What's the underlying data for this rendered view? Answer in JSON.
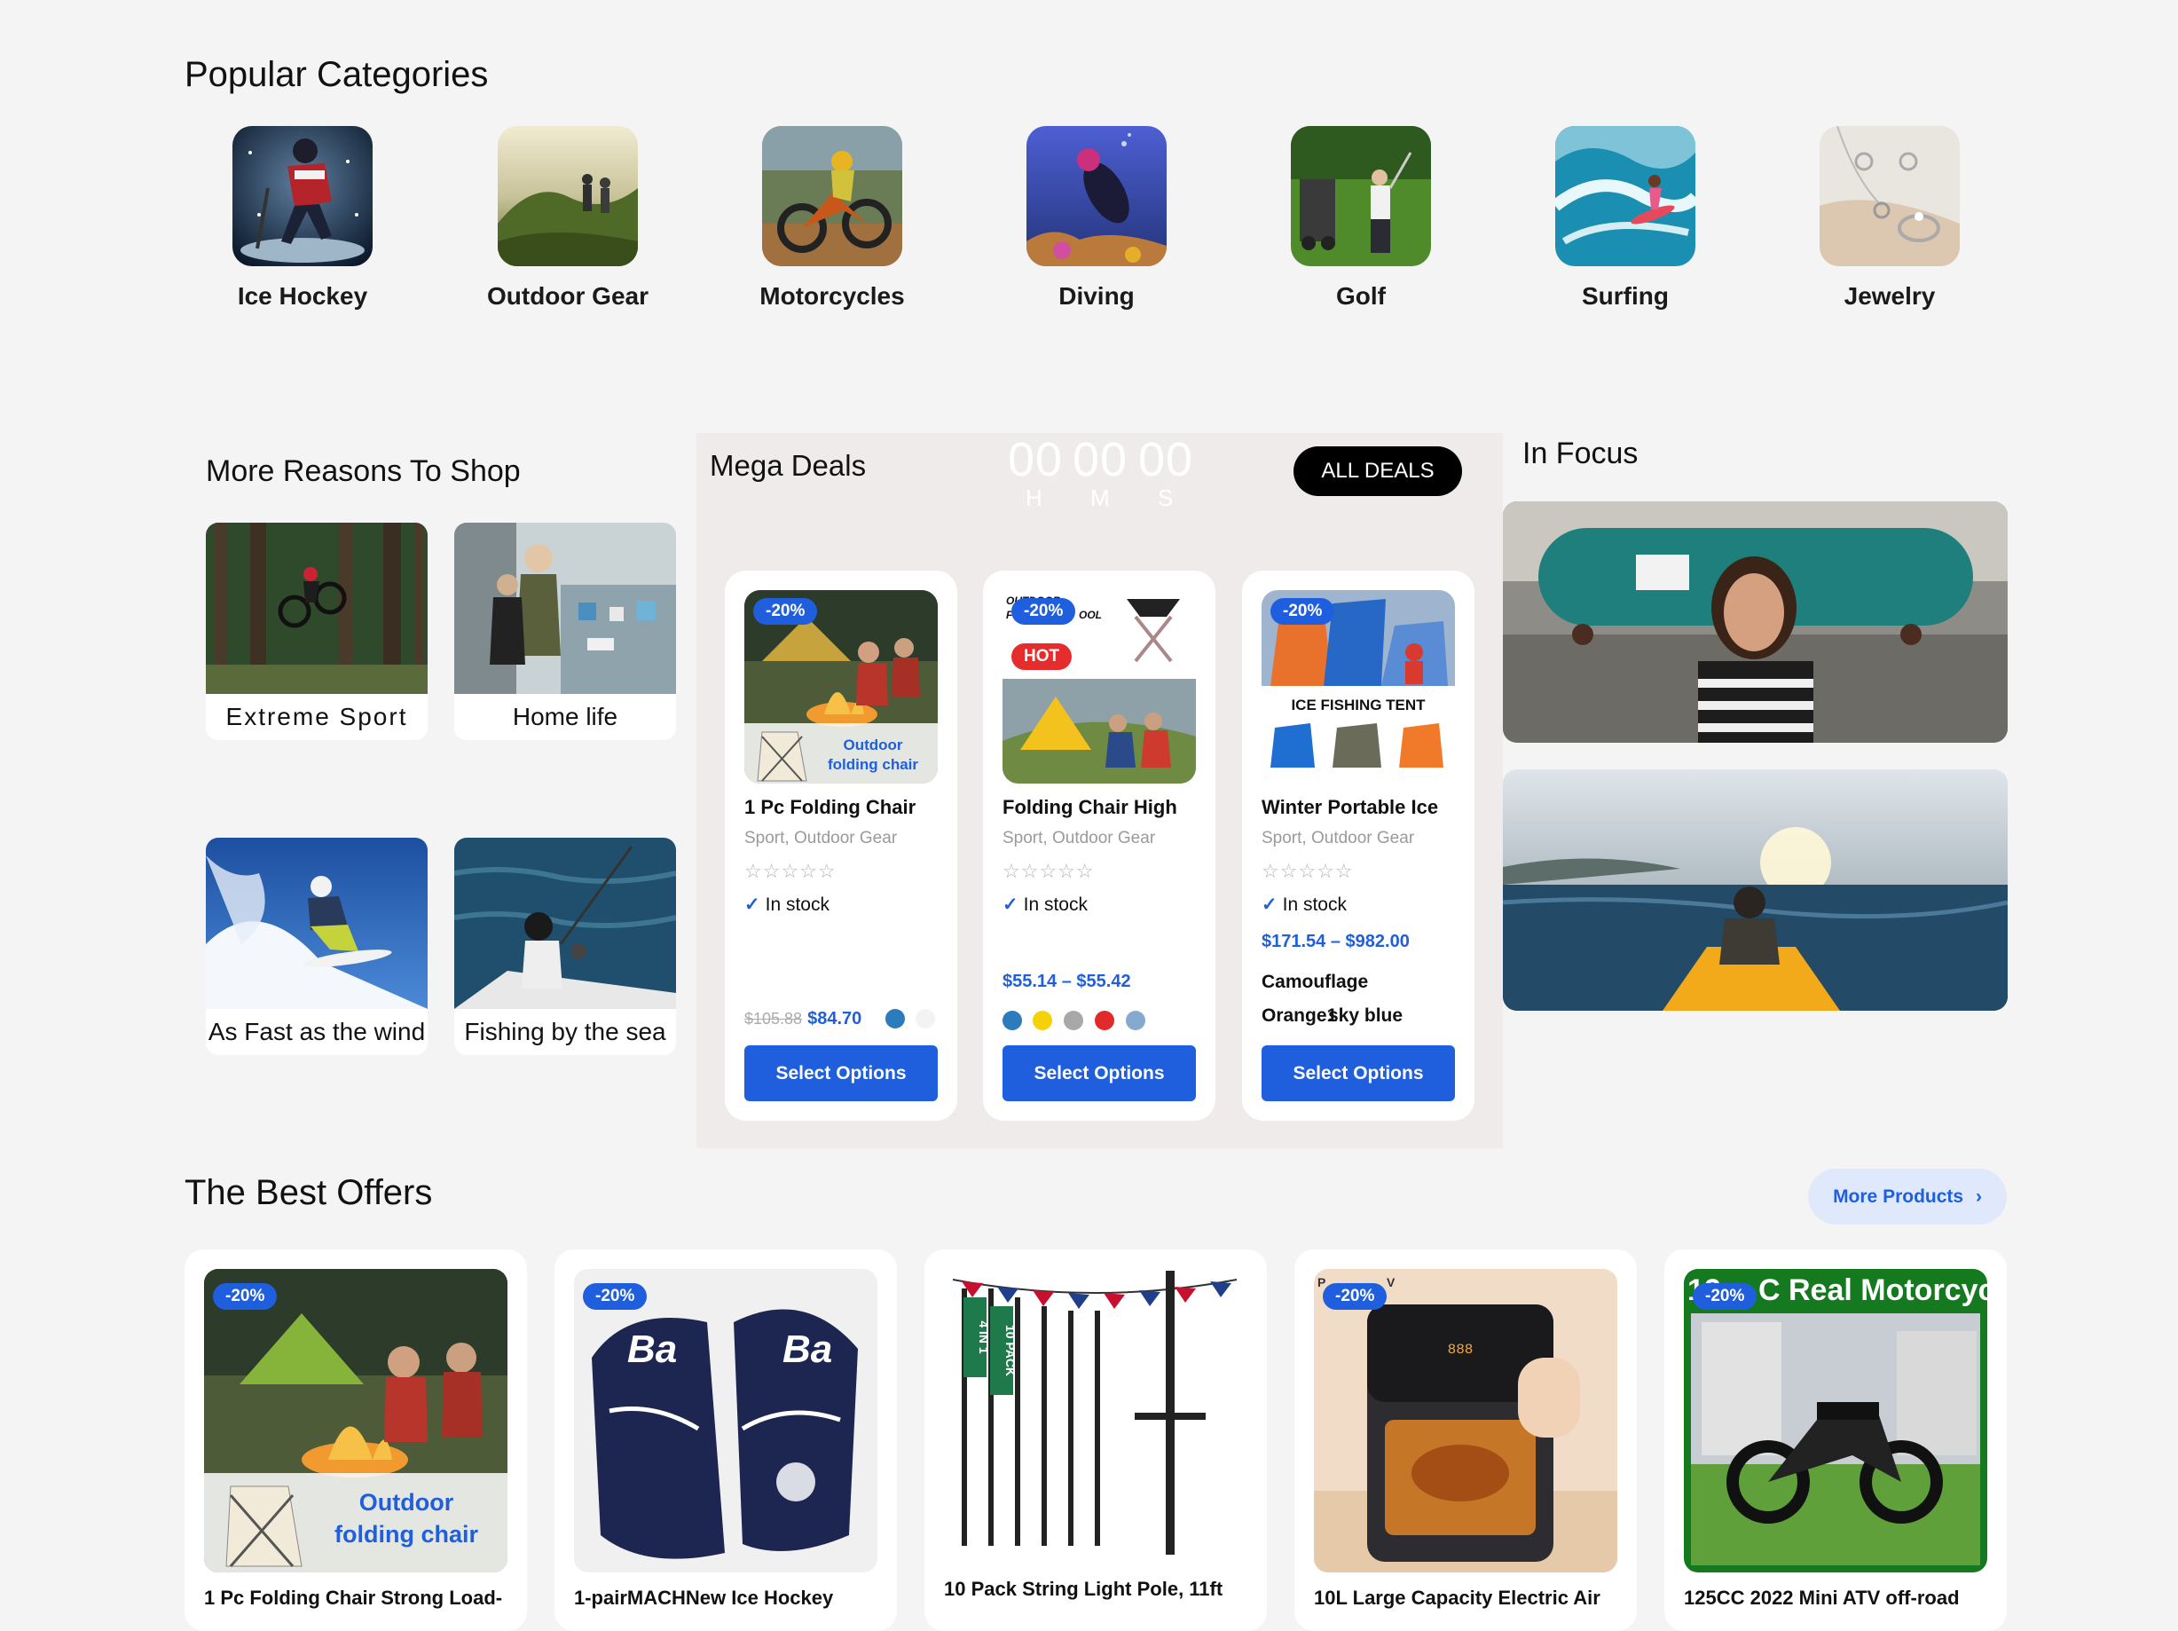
{
  "sections": {
    "popular": "Popular Categories",
    "reasons": "More Reasons To Shop",
    "mega": "Mega Deals",
    "focus": "In Focus",
    "offers": "The Best Offers"
  },
  "categories": [
    {
      "label": "Ice Hockey"
    },
    {
      "label": "Outdoor Gear"
    },
    {
      "label": "Motorcycles"
    },
    {
      "label": "Diving"
    },
    {
      "label": "Golf"
    },
    {
      "label": "Surfing"
    },
    {
      "label": "Jewelry"
    }
  ],
  "reasons": [
    {
      "label": "Extreme Sport"
    },
    {
      "label": "Home life"
    },
    {
      "label": "As Fast as the wind"
    },
    {
      "label": "Fishing by the sea"
    }
  ],
  "countdown": {
    "hours": "00",
    "minutes": "00",
    "seconds": "00",
    "h": "H",
    "m": "M",
    "s": "S",
    "all_deals": "ALL DEALS"
  },
  "deals": [
    {
      "badge": "-20%",
      "image_text": [
        "Outdoor",
        "folding chair"
      ],
      "title": "1 Pc Folding Chair",
      "cats": "Sport, Outdoor Gear",
      "stars": "☆☆☆☆☆",
      "stock": "In stock",
      "old_price": "$105.88",
      "price": "$84.70",
      "swatches": [
        "#2c7bbd",
        "#f3f3f3"
      ],
      "button": "Select Options"
    },
    {
      "badge": "-20%",
      "hot": "HOT",
      "image_text": [
        "OUTDOOR",
        "F",
        "OOL"
      ],
      "title": "Folding Chair High",
      "cats": "Sport, Outdoor Gear",
      "stars": "☆☆☆☆☆",
      "stock": "In stock",
      "price": "$55.14 – $55.42",
      "swatches": [
        "#2c7bbd",
        "#f5d10a",
        "#a8a8a8",
        "#e12b2b",
        "#86a9cf"
      ],
      "button": "Select Options"
    },
    {
      "badge": "-20%",
      "image_text": [
        "ICE FISHING TENT"
      ],
      "title": "Winter Portable Ice",
      "cats": "Sport, Outdoor Gear",
      "stars": "☆☆☆☆☆",
      "stock": "In stock",
      "price": "$171.54 – $982.00",
      "options": [
        "Camouflage",
        "Orange1",
        "sky blue"
      ],
      "button": "Select Options"
    }
  ],
  "offers_button": "More Products",
  "offers": [
    {
      "badge": "-20%",
      "title": "1 Pc Folding Chair Strong Load-",
      "image_text": [
        "Outdoor",
        "folding chair"
      ]
    },
    {
      "badge": "-20%",
      "title": "1-pairMACHNew Ice Hockey",
      "image_text": [
        "Ba",
        "Ba"
      ]
    },
    {
      "title": "10 Pack String Light Pole, 11ft",
      "image_text": [
        "4 IN 1",
        "10 PACK"
      ]
    },
    {
      "badge": "-20%",
      "title": "10L Large Capacity Electric Air",
      "image_text": [
        "P",
        "V",
        "888"
      ]
    },
    {
      "badge": "-20%",
      "title": "125CC 2022 Mini ATV off-road",
      "image_text": [
        "12",
        "C Real Motorcycle"
      ]
    }
  ],
  "colors": {
    "accent": "#1f5fde",
    "hot": "#e52d2d",
    "mega_bg": "#efebeb",
    "page_bg": "#f4f4f4"
  }
}
